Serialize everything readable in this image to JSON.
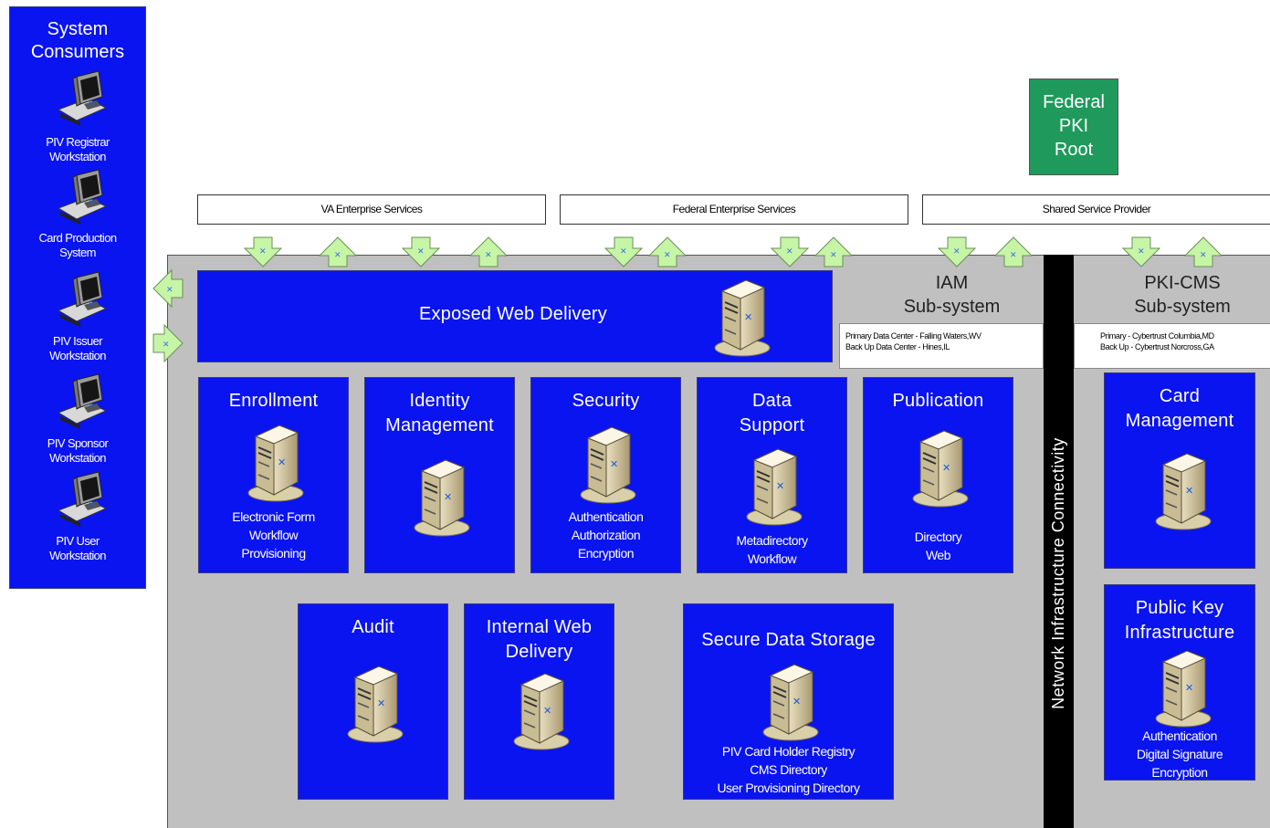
{
  "consumers": {
    "title": "System\nConsumers",
    "items": [
      {
        "label": "PIV Registrar\nWorkstation",
        "icon": "workstation-icon"
      },
      {
        "label": "Card Production\nSystem",
        "icon": "workstation-icon"
      },
      {
        "label": "PIV Issuer\nWorkstation",
        "icon": "workstation-icon"
      },
      {
        "label": "PIV Sponsor\nWorkstation",
        "icon": "workstation-icon"
      },
      {
        "label": "PIV User\nWorkstation",
        "icon": "workstation-icon"
      }
    ]
  },
  "federal_pki_root": "Federal\nPKI\nRoot",
  "services": {
    "va": "VA Enterprise Services",
    "federal": "Federal Enterprise Services",
    "shared": "Shared Service Provider"
  },
  "iam": {
    "title": "IAM\nSub-system",
    "note": "Primary Data Center - Falling Waters,WV\nBack Up Data Center - Hines,IL"
  },
  "pki_cms": {
    "title": "PKI-CMS\nSub-system",
    "note": "Primary - Cybertrust Columbia,MD\nBack Up - Cybertrust Norcross,GA"
  },
  "network_label": "Network Infrastructure Connectivity",
  "exposed_web": "Exposed Web Delivery",
  "components": {
    "enrollment": {
      "title": "Enrollment",
      "sub": "Electronic Form\nWorkflow\nProvisioning"
    },
    "identity": {
      "title": "Identity\nManagement",
      "sub": ""
    },
    "security": {
      "title": "Security",
      "sub": "Authentication\nAuthorization\nEncryption"
    },
    "data_support": {
      "title": "Data\nSupport",
      "sub": "Metadirectory\nWorkflow"
    },
    "publication": {
      "title": "Publication",
      "sub": "Directory\nWeb"
    },
    "audit": {
      "title": "Audit",
      "sub": ""
    },
    "internal_web": {
      "title": "Internal Web\nDelivery",
      "sub": ""
    },
    "secure_storage": {
      "title": "Secure Data Storage",
      "sub": "PIV Card Holder Registry\nCMS Directory\nUser Provisioning Directory"
    },
    "card_mgmt": {
      "title": "Card\nManagement",
      "sub": ""
    },
    "pki": {
      "title": "Public Key\nInfrastructure",
      "sub": "Authentication\nDigital Signature\nEncryption"
    }
  },
  "colors": {
    "component_blue": "#0a14f0",
    "pki_root_green": "#1f9a5c",
    "subsystem_gray": "#c0c0c0",
    "arrow_green": "#c6f5a6"
  }
}
